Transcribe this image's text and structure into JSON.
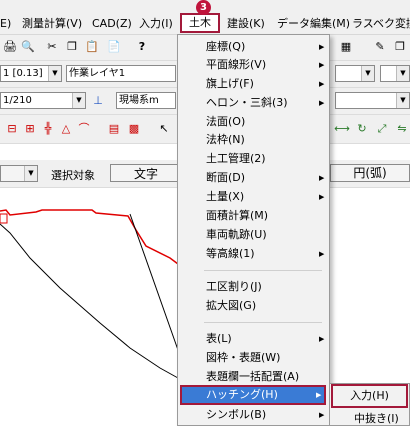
{
  "menubar": {
    "items": [
      "E)",
      "測量計算(V)",
      "CAD(Z)",
      "入力(I)",
      "建設(K)",
      "データ編集(M)",
      "ラスベク変換"
    ],
    "active": "土木(C)",
    "step_badge": "3"
  },
  "toolbar2": {
    "scale": "1 [0.13]",
    "layer": "作業レイヤ1"
  },
  "toolbar3": {
    "ratio": "1/210",
    "coord": "現場系m"
  },
  "toolbar5": {
    "select_label": "選択対象",
    "text_button": "文字",
    "circle_button": "円(弧)"
  },
  "menu": {
    "items": [
      {
        "label": "座標(Q)",
        "arrow": true
      },
      {
        "label": "平面線形(V)",
        "arrow": true
      },
      {
        "label": "旗上げ(F)",
        "arrow": true
      },
      {
        "label": "ヘロン・三斜(3)",
        "arrow": true
      },
      {
        "label": "法面(O)",
        "arrow": false
      },
      {
        "label": "法枠(N)",
        "arrow": false
      },
      {
        "label": "土工管理(2)",
        "arrow": false
      },
      {
        "label": "断面(D)",
        "arrow": true
      },
      {
        "label": "土量(X)",
        "arrow": true
      },
      {
        "label": "面積計算(M)",
        "arrow": false
      },
      {
        "label": "車両軌跡(U)",
        "arrow": false
      },
      {
        "label": "等高線(1)",
        "arrow": true
      },
      {
        "label": "工区割り(J)",
        "arrow": false
      },
      {
        "label": "拡大図(G)",
        "arrow": false
      },
      {
        "label": "表(L)",
        "arrow": true
      },
      {
        "label": "図枠・表題(W)",
        "arrow": false
      },
      {
        "label": "表題欄一括配置(A)",
        "arrow": false
      },
      {
        "label": "ハッチング(H)",
        "arrow": true
      },
      {
        "label": "シンボル(B)",
        "arrow": true
      }
    ]
  },
  "submenu": {
    "items": [
      "入力(H)",
      "中抜き(I)"
    ]
  },
  "icons": {
    "sub_arrow": "▶",
    "dropdown": "▼"
  },
  "colors": {
    "accent": "#a3193a",
    "highlight": "#3a7bd5",
    "line": "#e00000"
  }
}
